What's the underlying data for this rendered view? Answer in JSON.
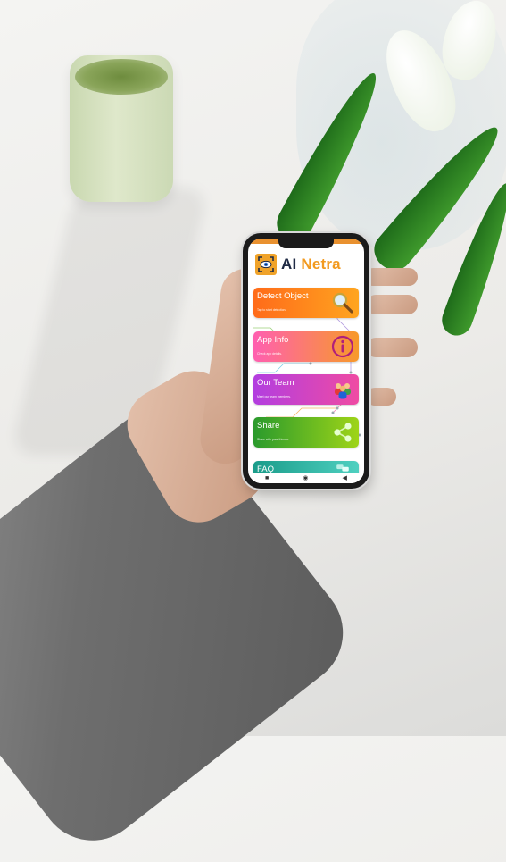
{
  "app": {
    "title_part1": "AI",
    "title_part2": "Netra",
    "accent_color": "#f29a1f",
    "title_color": "#1f2a44",
    "logo_icon": "eye-scan-icon"
  },
  "menu": [
    {
      "title": "Detect Object",
      "subtitle": "Tap to start detection.",
      "icon": "magnifier-icon",
      "colors": [
        "#ff6b1a",
        "#ffa51f"
      ]
    },
    {
      "title": "App Info",
      "subtitle": "Check app details.",
      "icon": "info-icon",
      "colors": [
        "#ff5fb0",
        "#f79a2a"
      ]
    },
    {
      "title": "Our Team",
      "subtitle": "Meet our team members.",
      "icon": "team-icon",
      "colors": [
        "#b23ee0",
        "#ef4ba3"
      ]
    },
    {
      "title": "Share",
      "subtitle": "Share with your friends.",
      "icon": "share-icon",
      "colors": [
        "#2a9a2c",
        "#9ed418"
      ]
    },
    {
      "title": "FAQ",
      "subtitle": "",
      "icon": "faq-icon",
      "colors": [
        "#1a9c8a",
        "#4fd0c0"
      ]
    }
  ],
  "navbar": {
    "recents": "■",
    "home": "◉",
    "back": "◀",
    "recents_icon": "recents-icon",
    "home_icon": "home-icon",
    "back_icon": "back-icon"
  }
}
